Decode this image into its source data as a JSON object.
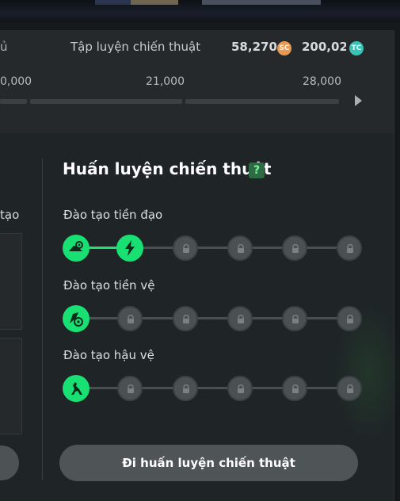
{
  "header": {
    "cut_label": "ủ",
    "title": "Tập luyện chiến thuật",
    "sc_value": "58,270",
    "sc_icon": "SC",
    "tc_value": "200,020",
    "tc_icon": "TC"
  },
  "progress": {
    "ticks": [
      "0,000",
      "21,000",
      "28,000"
    ]
  },
  "left_panel": {
    "label_stub": "tạo"
  },
  "training": {
    "title": "Huấn luyện chiến thuật",
    "help": "?",
    "tracks": [
      {
        "label": "Đào tạo tiền đạo",
        "unlocked": 2,
        "total": 6
      },
      {
        "label": "Đào tạo tiền vệ",
        "unlocked": 1,
        "total": 6
      },
      {
        "label": "Đào tạo hậu vệ",
        "unlocked": 1,
        "total": 6
      }
    ],
    "button": "Đi huấn luyện chiến thuật"
  },
  "colors": {
    "accent_green": "#19e073",
    "locked_node": "#4b5052",
    "sc_coin": "#e99a52",
    "tc_coin": "#38c3b7"
  }
}
